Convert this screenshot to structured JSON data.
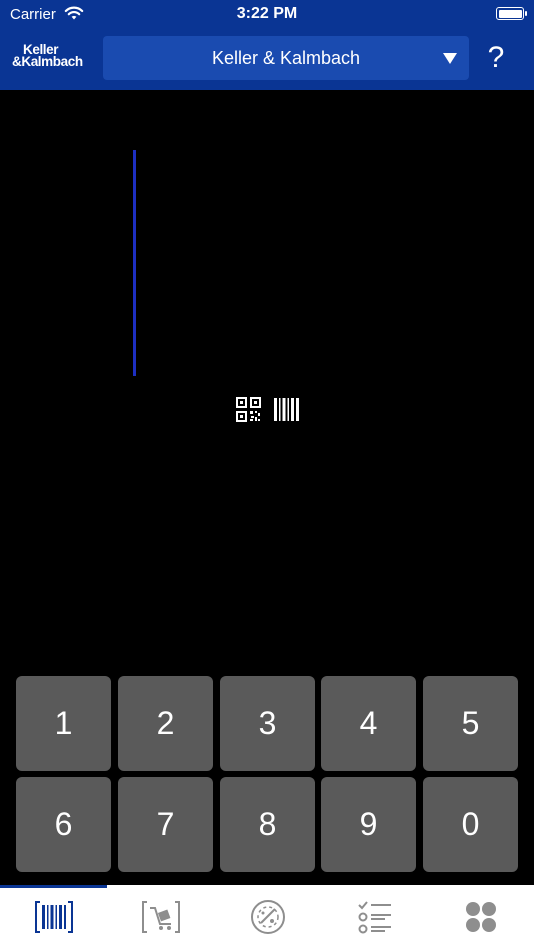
{
  "status_bar": {
    "carrier": "Carrier",
    "time": "3:22 PM",
    "icons": [
      "wifi-icon",
      "battery-icon"
    ]
  },
  "header": {
    "logo_line1": "Keller",
    "logo_line2": "&Kalmbach",
    "selected_company": "Keller & Kalmbach",
    "help_label": "?"
  },
  "scanner": {
    "icons": [
      "qr-code-icon",
      "barcode-icon"
    ]
  },
  "keypad": {
    "keys": [
      "1",
      "2",
      "3",
      "4",
      "5",
      "6",
      "7",
      "8",
      "9",
      "0"
    ]
  },
  "tab_bar": {
    "tabs": [
      "scan-tab-barcode-icon",
      "cart-tab-icon",
      "bin-tab-icon",
      "checklist-tab-icon",
      "more-apps-tab-icon"
    ],
    "active_tab": 0
  },
  "colors": {
    "brand_blue": "#0a3594",
    "select_blue": "#1a4bb0",
    "key_gray": "#5a5a5a",
    "icon_gray": "#8e8e8e"
  }
}
